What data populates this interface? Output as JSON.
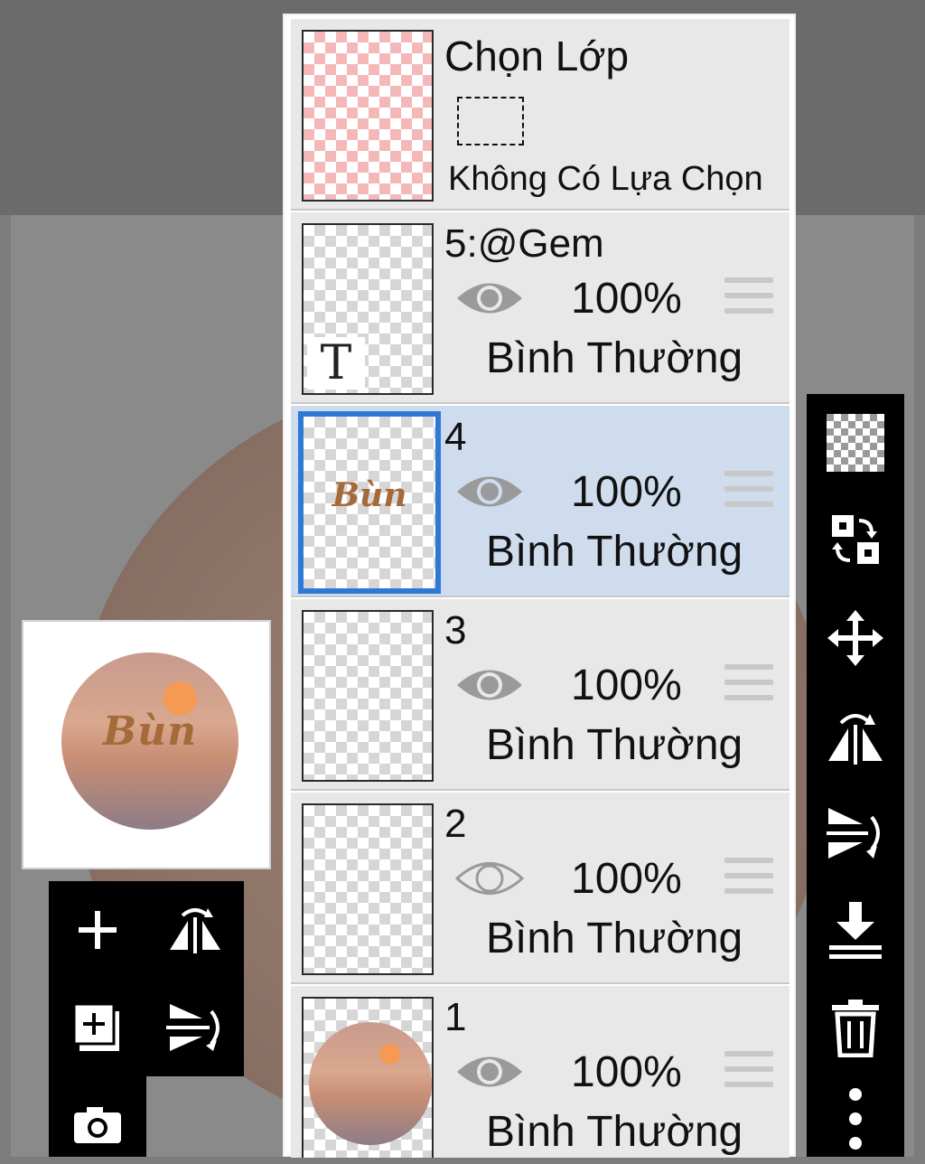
{
  "selection_layer": {
    "title": "Chọn Lớp",
    "status": "Không Có Lựa Chọn"
  },
  "layers": [
    {
      "name": "5:@Gem",
      "opacity": "100%",
      "blend": "Bình Thường",
      "visible": true,
      "thumb_glyph": "T"
    },
    {
      "name": "4",
      "opacity": "100%",
      "blend": "Bình Thường",
      "visible": true,
      "selected": true,
      "thumb_text": "Bùn"
    },
    {
      "name": "3",
      "opacity": "100%",
      "blend": "Bình Thường",
      "visible": true
    },
    {
      "name": "2",
      "opacity": "100%",
      "blend": "Bình Thường",
      "visible": false
    },
    {
      "name": "1",
      "opacity": "100%",
      "blend": "Bình Thường",
      "visible": true
    }
  ],
  "preview": {
    "text": "Bùn"
  },
  "left_tools": [
    "add-layer-icon",
    "flip-horizontal-icon",
    "add-copy-layer-icon",
    "flip-vertical-icon",
    "camera-icon"
  ],
  "right_tools": [
    "transparency-icon",
    "swap-icon",
    "move-icon",
    "flip-horizontal-icon",
    "flip-vertical-icon",
    "merge-down-icon",
    "trash-icon",
    "more-icon"
  ],
  "colors": {
    "selected_layer": "#cfdcee",
    "selected_border": "#2f79d6",
    "panel": "#e8e8e8"
  }
}
